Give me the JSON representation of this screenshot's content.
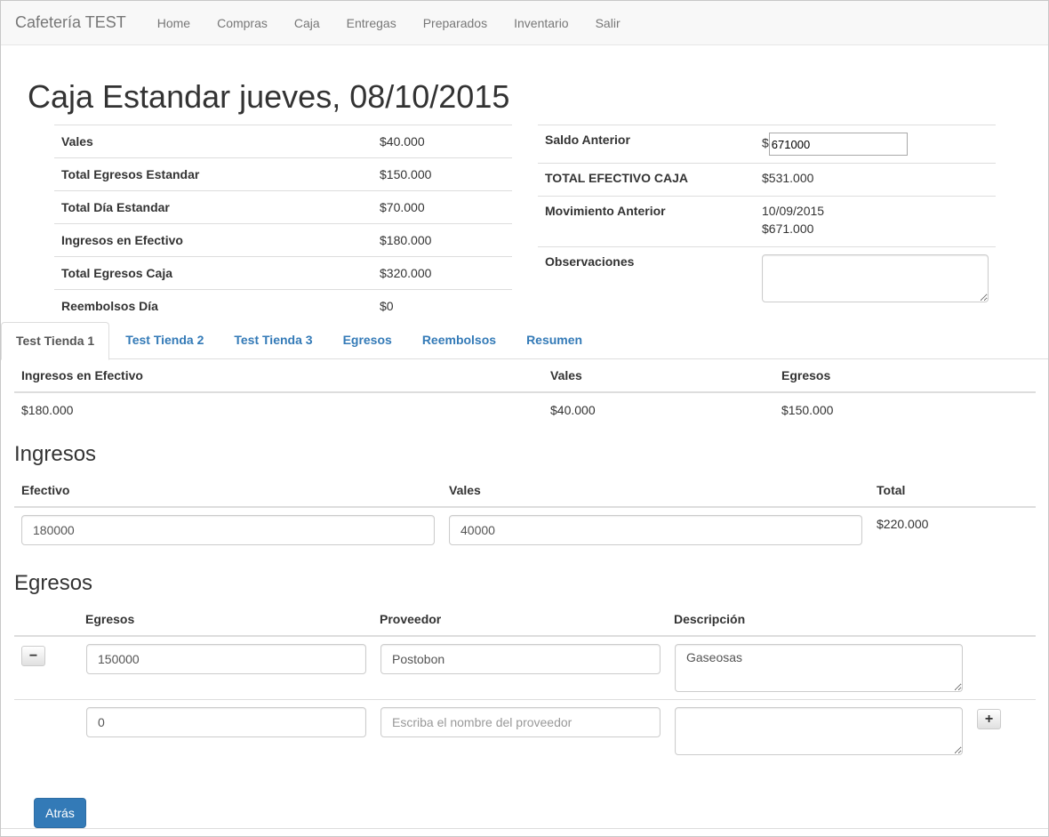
{
  "navbar": {
    "brand": "Cafetería TEST",
    "links": [
      "Home",
      "Compras",
      "Caja",
      "Entregas",
      "Preparados",
      "Inventario",
      "Salir"
    ]
  },
  "page_title": "Caja Estandar jueves, 08/10/2015",
  "summary_left": [
    {
      "label": "Vales",
      "value": "$40.000"
    },
    {
      "label": "Total Egresos Estandar",
      "value": "$150.000"
    },
    {
      "label": "Total Día Estandar",
      "value": "$70.000"
    },
    {
      "label": "Ingresos en Efectivo",
      "value": "$180.000"
    },
    {
      "label": "Total Egresos Caja",
      "value": "$320.000"
    },
    {
      "label": "Reembolsos Día",
      "value": "$0"
    }
  ],
  "summary_right": {
    "saldo_label": "Saldo Anterior",
    "saldo_prefix": "$",
    "saldo_value": "671000",
    "total_label": "TOTAL EFECTIVO CAJA",
    "total_value": "$531.000",
    "mov_label": "Movimiento Anterior",
    "mov_date": "10/09/2015",
    "mov_value": "$671.000",
    "obs_label": "Observaciones",
    "obs_value": ""
  },
  "tabs": [
    "Test Tienda 1",
    "Test Tienda 2",
    "Test Tienda 3",
    "Egresos",
    "Reembolsos",
    "Resumen"
  ],
  "active_tab": 0,
  "store_table": {
    "headers": [
      "Ingresos en Efectivo",
      "Vales",
      "Egresos"
    ],
    "row": [
      "$180.000",
      "$40.000",
      "$150.000"
    ]
  },
  "ingresos": {
    "heading": "Ingresos",
    "headers": [
      "Efectivo",
      "Vales",
      "Total"
    ],
    "efectivo": "180000",
    "vales": "40000",
    "total": "$220.000"
  },
  "egresos": {
    "heading": "Egresos",
    "headers": [
      "Egresos",
      "Proveedor",
      "Descripción"
    ],
    "rows": [
      {
        "monto": "150000",
        "proveedor": "Postobon",
        "descripcion": "Gaseosas"
      },
      {
        "monto": "0",
        "proveedor": "",
        "descripcion": ""
      }
    ],
    "proveedor_placeholder": "Escriba el nombre del proveedor",
    "remove_label": "−",
    "add_label": "+"
  },
  "back_button": "Atrás",
  "colors": {
    "link": "#337ab7",
    "primary": "#337ab7",
    "navbar_bg": "#f8f8f8"
  }
}
